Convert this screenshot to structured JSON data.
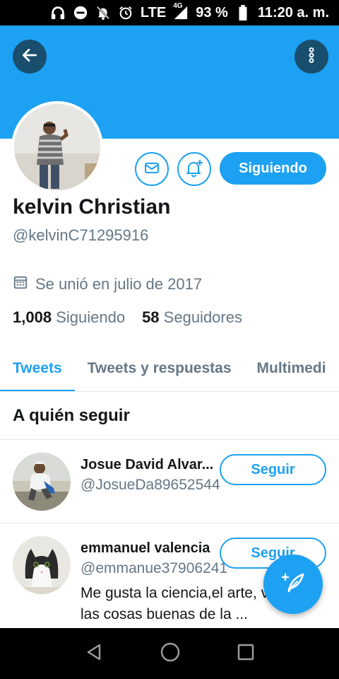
{
  "status_bar": {
    "network": "LTE",
    "network_sub": "4G",
    "battery": "93 %",
    "time": "11:20 a. m."
  },
  "profile": {
    "name": "kelvin Christian",
    "handle": "@kelvinC71295916",
    "joined": "Se unió en julio de 2017",
    "following_count": "1,008",
    "following_label": "Siguiendo",
    "followers_count": "58",
    "followers_label": "Seguidores",
    "following_button": "Siguiendo"
  },
  "tabs": [
    {
      "label": "Tweets"
    },
    {
      "label": "Tweets y respuestas"
    },
    {
      "label": "Multimedi"
    }
  ],
  "who_to_follow": {
    "title": "A quién seguir",
    "users": [
      {
        "name": "Josue David Alvar...",
        "handle": "@JosueDa89652544",
        "button": "Seguir",
        "bio": ""
      },
      {
        "name": "emmanuel valencia",
        "handle": "@emmanue37906241",
        "button": "Seguir",
        "bio": "Me gusta la ciencia,el arte, viajes y las cosas buenas  de la ..."
      }
    ]
  },
  "colors": {
    "accent": "#1da1f2",
    "banner_button": "#1a4e6e",
    "secondary_text": "#657786"
  },
  "icons": {
    "back": "arrow-left-icon",
    "more": "more-vertical-icon",
    "message": "envelope-icon",
    "notify": "bell-plus-icon",
    "calendar": "calendar-icon",
    "compose": "feather-plus-icon"
  }
}
